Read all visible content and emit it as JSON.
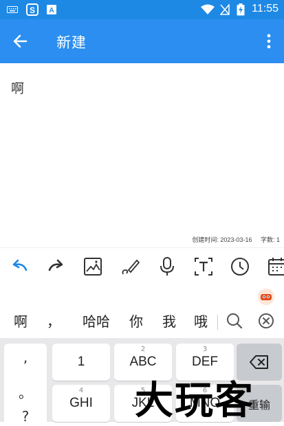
{
  "status_bar": {
    "time": "11:55",
    "icons": [
      "keyboard-icon",
      "app-s-icon",
      "app-a-icon",
      "wifi-icon",
      "no-signal-icon",
      "battery-charging-icon"
    ]
  },
  "app_bar": {
    "title": "新建",
    "back_icon": "arrow-left-icon",
    "more_icon": "more-vertical-icon",
    "color": "#2b8ef0"
  },
  "editor": {
    "content": "啊",
    "created_label": "创建时间: 2023-03-16",
    "word_count_label": "字数: 1"
  },
  "toolbar": {
    "tools": [
      "undo-icon",
      "redo-icon",
      "image-icon",
      "draw-icon",
      "microphone-icon",
      "text-format-icon",
      "clock-icon",
      "calendar-icon"
    ]
  },
  "candidates": {
    "items": [
      "啊",
      "，",
      "哈哈",
      "你",
      "我",
      "哦"
    ]
  },
  "keyboard": {
    "punct": [
      ",",
      "。",
      "?"
    ],
    "keys": [
      {
        "digit": "",
        "label": "1"
      },
      {
        "digit": "2",
        "label": "ABC"
      },
      {
        "digit": "3",
        "label": "DEF"
      },
      {
        "digit": "4",
        "label": "GHI"
      },
      {
        "digit": "5",
        "label": "JKL"
      },
      {
        "digit": "6",
        "label": "MNO"
      }
    ],
    "repick_label": "重输"
  },
  "watermark": "大玩客"
}
